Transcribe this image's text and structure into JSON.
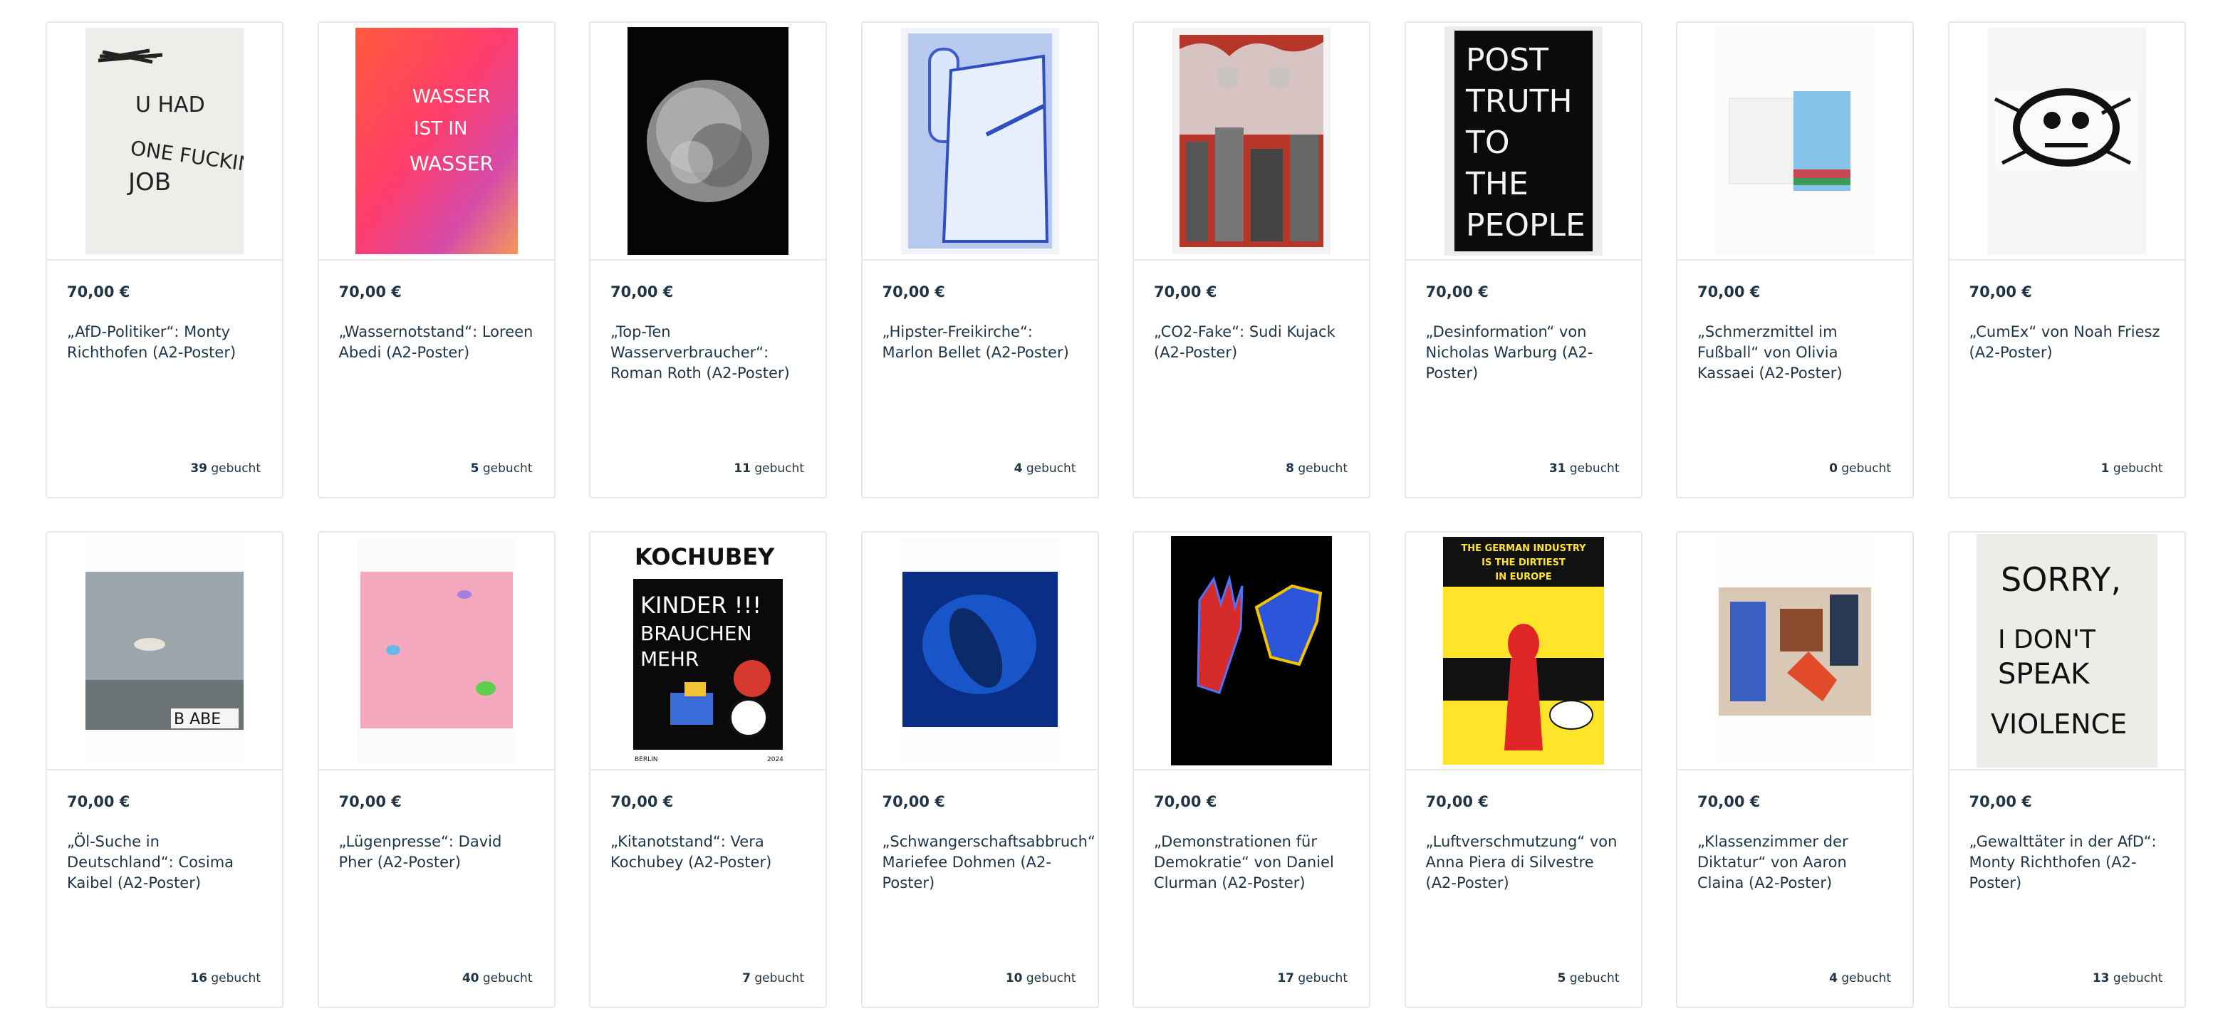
{
  "booked_suffix": "gebucht",
  "products": [
    {
      "price": "70,00 €",
      "title": "„AfD-Politiker“: Monty Richthofen (A2-Poster)",
      "booked_count": "39",
      "art_text": [
        "U HAD",
        "ONE FUCKING",
        "JOB"
      ]
    },
    {
      "price": "70,00 €",
      "title": "„Wassernotstand“: Loreen Abedi (A2-Poster)",
      "booked_count": "5",
      "art_text": [
        "WASSER",
        "IST IN",
        "WASSER"
      ]
    },
    {
      "price": "70,00 €",
      "title": "„Top-Ten Wasserverbraucher“: Roman Roth (A2-Poster)",
      "booked_count": "11"
    },
    {
      "price": "70,00 €",
      "title": "„Hipster-Freikirche“: Marlon Bellet (A2-Poster)",
      "booked_count": "4"
    },
    {
      "price": "70,00 €",
      "title": "„CO2-Fake“: Sudi Kujack (A2-Poster)",
      "booked_count": "8"
    },
    {
      "price": "70,00 €",
      "title": "„Desinformation“ von Nicholas Warburg (A2-Poster)",
      "booked_count": "31",
      "art_text": [
        "POST",
        "TRUTH",
        "TO",
        "THE",
        "PEOPLE"
      ]
    },
    {
      "price": "70,00 €",
      "title": "„Schmerzmittel im Fußball“ von Olivia Kassaei (A2-Poster)",
      "booked_count": "0"
    },
    {
      "price": "70,00 €",
      "title": "„CumEx“ von Noah Friesz (A2-Poster)",
      "booked_count": "1"
    },
    {
      "price": "70,00 €",
      "title": "„Öl-Suche in Deutschland“: Cosima Kaibel (A2-Poster)",
      "booked_count": "16",
      "art_text": [
        "B ABE"
      ]
    },
    {
      "price": "70,00 €",
      "title": "„Lügenpresse“: David Pher (A2-Poster)",
      "booked_count": "40"
    },
    {
      "price": "70,00 €",
      "title": "„Kitanotstand“: Vera Kochubey (A2-Poster)",
      "booked_count": "7",
      "art_text": [
        "KOCHUBEY",
        "KINDER !!!",
        "BRAUCHEN",
        "MEHR",
        "BERLIN",
        "2024"
      ]
    },
    {
      "price": "70,00 €",
      "title": "„Schwangerschaftsabbruch“ Mariefee Dohmen (A2-Poster)",
      "booked_count": "10"
    },
    {
      "price": "70,00 €",
      "title": "„Demonstrationen für Demokratie“ von Daniel Clurman (A2-Poster)",
      "booked_count": "17"
    },
    {
      "price": "70,00 €",
      "title": "„Luftverschmutzung“ von Anna Piera di Silvestre (A2-Poster)",
      "booked_count": "5",
      "art_text": [
        "THE GERMAN INDUSTRY",
        "IS THE DIRTIEST",
        "IN EUROPE"
      ]
    },
    {
      "price": "70,00 €",
      "title": "„Klassenzimmer der Diktatur“ von Aaron Claina (A2-Poster)",
      "booked_count": "4"
    },
    {
      "price": "70,00 €",
      "title": "„Gewalttäter in der AfD“: Monty Richthofen (A2-Poster)",
      "booked_count": "13",
      "art_text": [
        "SORRY,",
        "I DON'T",
        "SPEAK",
        "VIOLENCE"
      ]
    }
  ]
}
